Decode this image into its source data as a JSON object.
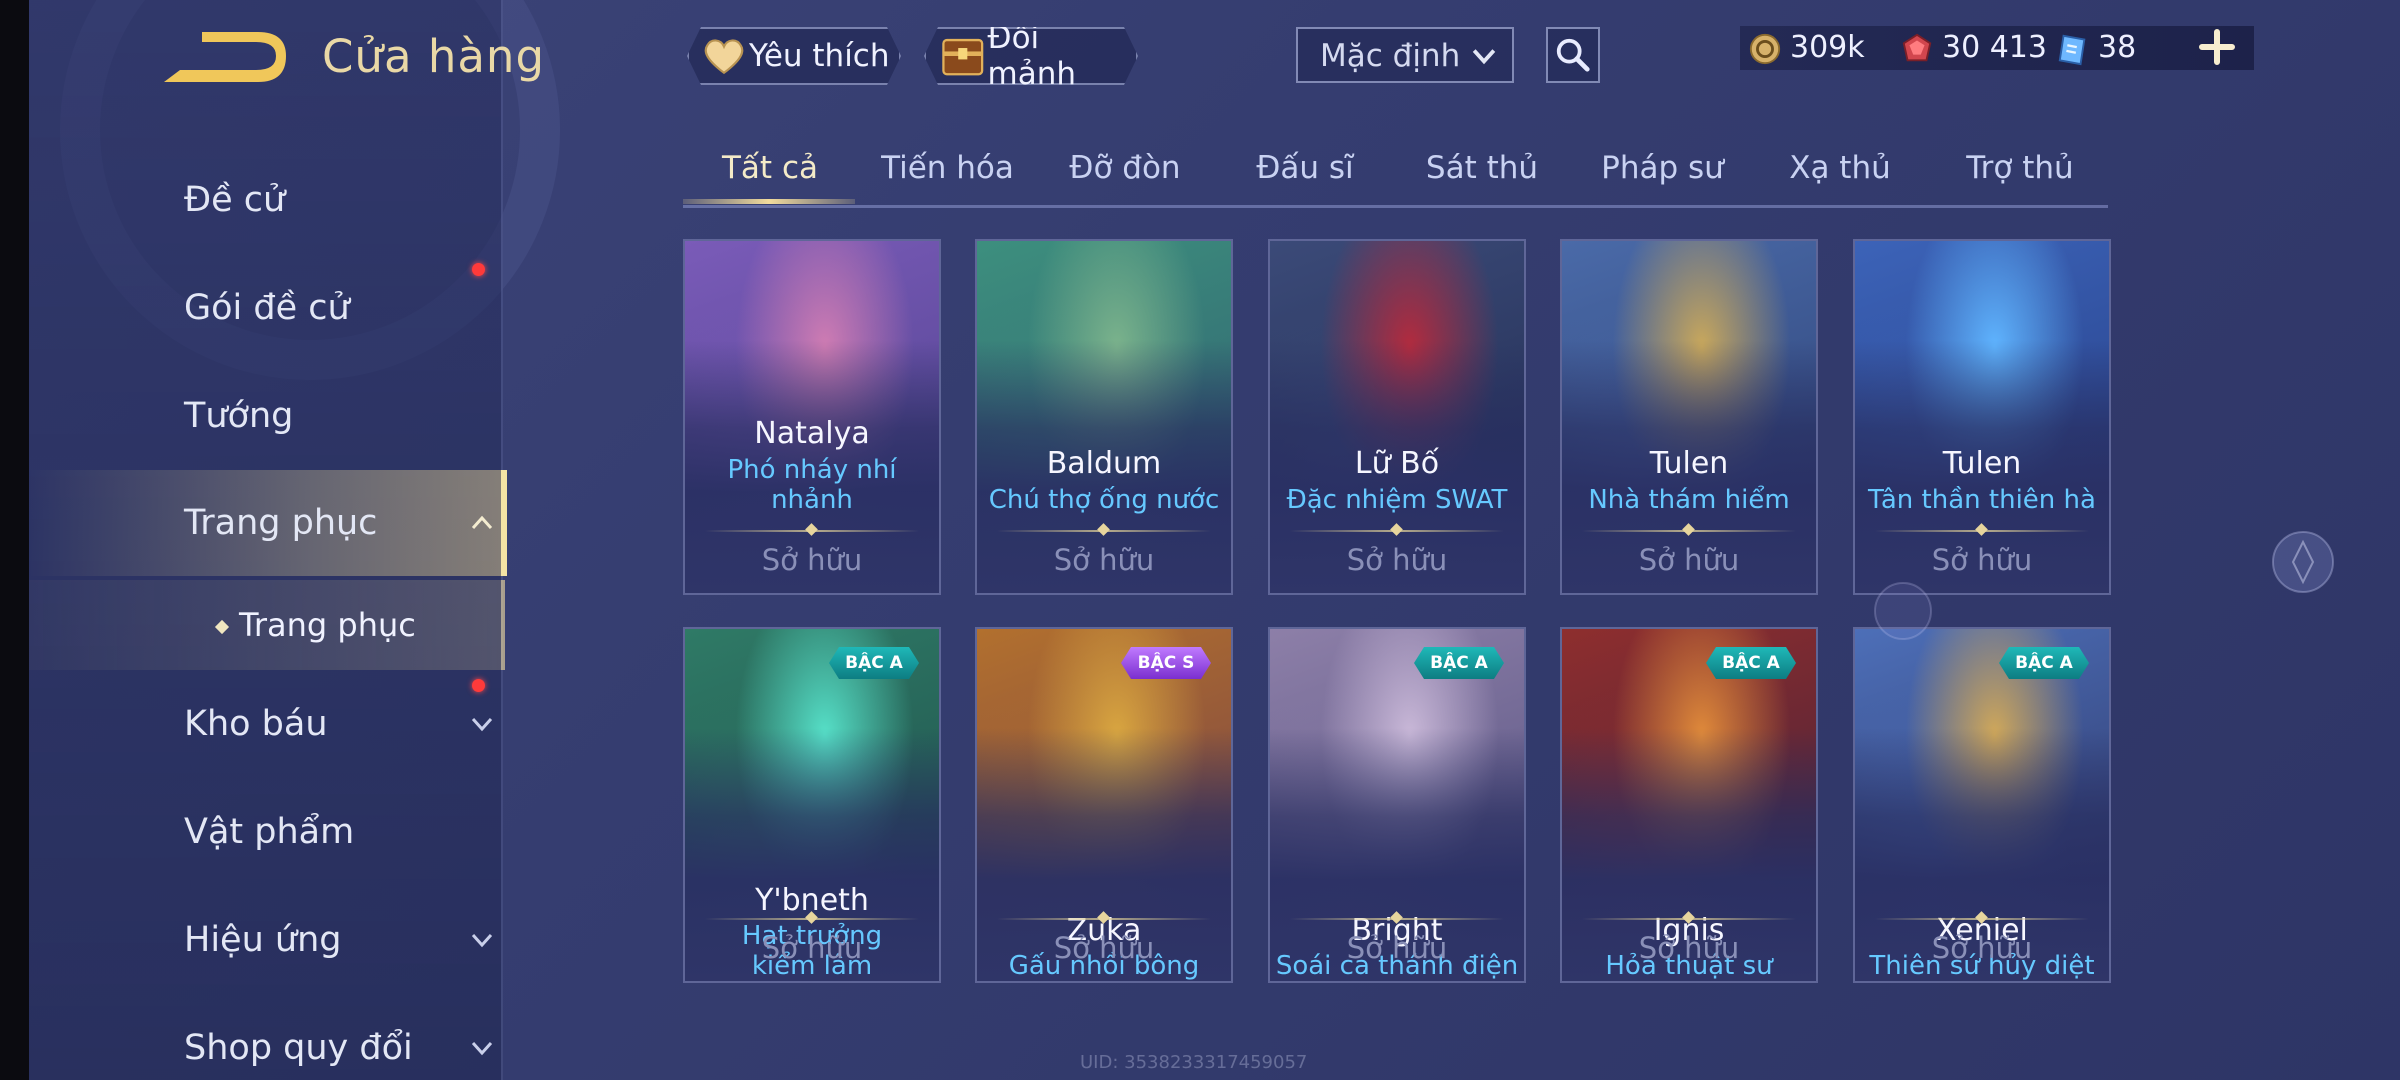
{
  "header": {
    "title": "Cửa hàng"
  },
  "sidebar": {
    "items": [
      {
        "label": "Đề cử"
      },
      {
        "label": "Gói đề cử"
      },
      {
        "label": "Tướng"
      },
      {
        "label": "Trang phục"
      },
      {
        "label": "Kho báu"
      },
      {
        "label": "Vật phẩm"
      },
      {
        "label": "Hiệu ứng"
      },
      {
        "label": "Shop quy đổi"
      }
    ],
    "sub_item": {
      "label": "Trang phục"
    }
  },
  "topbar": {
    "favorite_label": "Yêu thích",
    "exchange_label": "Đổi mảnh",
    "sort_selected": "Mặc định"
  },
  "currency": {
    "gold": "309k",
    "ruby": "30 413",
    "voucher": "38"
  },
  "tabs": [
    "Tất cả",
    "Tiến hóa",
    "Đỡ đòn",
    "Đấu sĩ",
    "Sát thủ",
    "Pháp sư",
    "Xạ thủ",
    "Trợ thủ"
  ],
  "cards": [
    {
      "hero": "Natalya",
      "skin": "Phó nháy nhí nhảnh",
      "status": "Sở hữu",
      "badge": "",
      "colors": [
        "#7a5bb8",
        "#4b3f8a",
        "#cf7cb3"
      ]
    },
    {
      "hero": "Baldum",
      "skin": "Chú thợ ống nước",
      "status": "Sở hữu",
      "badge": "",
      "colors": [
        "#3d8f7e",
        "#2e5a6e",
        "#7bb38c"
      ]
    },
    {
      "hero": "Lữ Bố",
      "skin": "Đặc nhiệm SWAT",
      "status": "Sở hữu",
      "badge": "",
      "colors": [
        "#3b4a78",
        "#1f2a4e",
        "#b32b3e"
      ]
    },
    {
      "hero": "Tulen",
      "skin": "Nhà thám hiểm",
      "status": "Sở hữu",
      "badge": "",
      "colors": [
        "#4a6aa8",
        "#2a3d70",
        "#c9a85c"
      ]
    },
    {
      "hero": "Tulen",
      "skin": "Tân thần thiên hà",
      "status": "Sở hữu",
      "badge": "",
      "colors": [
        "#3c63b8",
        "#233a80",
        "#5fb4ff"
      ]
    },
    {
      "hero": "Y'bneth",
      "skin": "Hạt trưởng kiểm lâm",
      "status": "Sở hữu",
      "badge": "BẬC A",
      "colors": [
        "#2f7a66",
        "#1c4a48",
        "#56e0c8"
      ]
    },
    {
      "hero": "Zuka",
      "skin": "Gấu nhồi bông",
      "status": "Sở hữu",
      "badge": "BẬC S",
      "colors": [
        "#b2702e",
        "#6e3a4a",
        "#d9a640"
      ]
    },
    {
      "hero": "Bright",
      "skin": "Soái ca thánh điện",
      "status": "Sở hữu",
      "badge": "BẬC A",
      "colors": [
        "#8d7fa8",
        "#4f4c7c",
        "#c9b8d8"
      ]
    },
    {
      "hero": "Ignis",
      "skin": "Hỏa thuật sư",
      "status": "Sở hữu",
      "badge": "BẬC A",
      "colors": [
        "#8e2e2e",
        "#3a1f3c",
        "#e08a3a"
      ]
    },
    {
      "hero": "Xeniel",
      "skin": "Thiên sứ hủy diệt",
      "status": "Sở hữu",
      "badge": "BẬC A",
      "colors": [
        "#4d6fb8",
        "#2a2f5e",
        "#d0a85a"
      ]
    }
  ],
  "footer": {
    "uid": "UID: 3538233317459057"
  },
  "theme": {
    "accent_gold": "#f2dc9c",
    "skin_name_blue": "#66c9ff",
    "notification_red": "#ff3a3a"
  }
}
